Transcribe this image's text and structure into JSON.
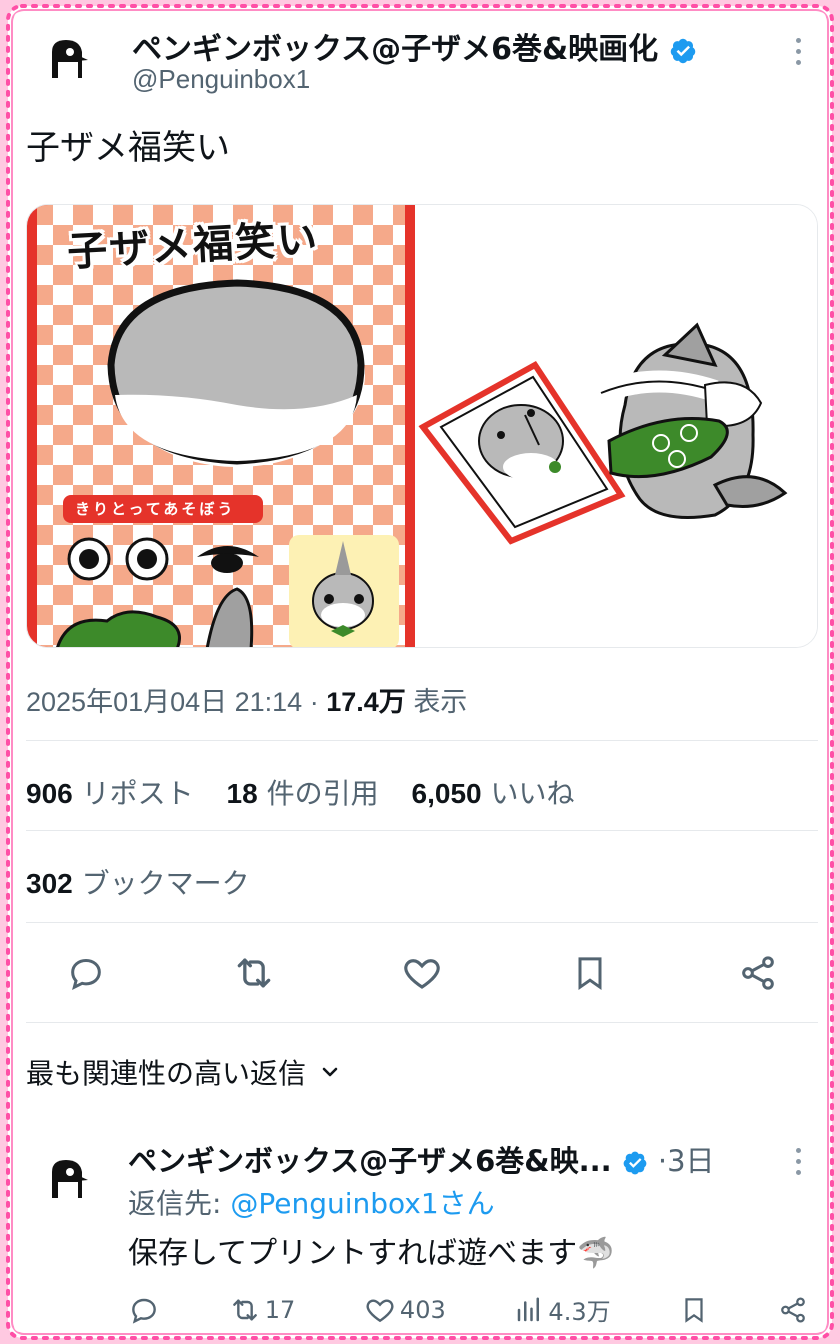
{
  "tweet": {
    "author_name": "ペンギンボックス@子ザメ6巻&映画化",
    "handle": "@Penguinbox1",
    "text": "子ザメ福笑い",
    "image_title": "子ザメ福笑い",
    "image_caption": "きりとってあそぼう",
    "timestamp": "2025年01月04日 21:14",
    "separator": "·",
    "views": "17.4万",
    "views_label": "表示",
    "reposts": "906",
    "reposts_label": "リポスト",
    "quotes": "18",
    "quotes_label": "件の引用",
    "likes": "6,050",
    "likes_label": "いいね",
    "bookmarks": "302",
    "bookmarks_label": "ブックマーク"
  },
  "replies_sort": {
    "label": "最も関連性の高い返信"
  },
  "reply": {
    "author_name": "ペンギンボックス@子ザメ6巻&映...",
    "time": "·3日",
    "reply_to_label": "返信先: ",
    "reply_to_handle": "@Penguinbox1さん",
    "text": "保存してプリントすれば遊べます🦈",
    "retweets": "17",
    "likes": "403",
    "views": "4.3万"
  },
  "colors": {
    "frame_pink": "#ff4fa6",
    "background_pink": "#ffc9e1",
    "verified_blue": "#1d9bf0",
    "text": "#0f1419",
    "muted": "#536471"
  },
  "icons": [
    "penguin-avatar-icon",
    "verified-icon",
    "more-icon",
    "reply-icon",
    "retweet-icon",
    "like-icon",
    "bookmark-icon",
    "share-icon",
    "chevron-down-icon",
    "views-icon"
  ]
}
